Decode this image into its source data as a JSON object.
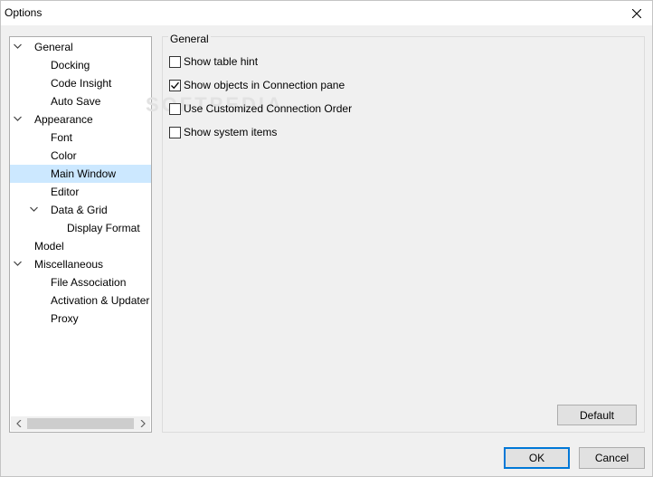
{
  "window": {
    "title": "Options"
  },
  "tree": {
    "items": [
      {
        "label": "General",
        "level": 0,
        "expanded": true
      },
      {
        "label": "Docking",
        "level": 1
      },
      {
        "label": "Code Insight",
        "level": 1
      },
      {
        "label": "Auto Save",
        "level": 1
      },
      {
        "label": "Appearance",
        "level": 0,
        "expanded": true
      },
      {
        "label": "Font",
        "level": 1
      },
      {
        "label": "Color",
        "level": 1
      },
      {
        "label": "Main Window",
        "level": 1,
        "selected": true
      },
      {
        "label": "Editor",
        "level": 1
      },
      {
        "label": "Data & Grid",
        "level": 1,
        "expanded": true
      },
      {
        "label": "Display Format",
        "level": 2
      },
      {
        "label": "Model",
        "level": 0
      },
      {
        "label": "Miscellaneous",
        "level": 0,
        "expanded": true
      },
      {
        "label": "File Association",
        "level": 1
      },
      {
        "label": "Activation & Updater",
        "level": 1
      },
      {
        "label": "Proxy",
        "level": 1
      }
    ]
  },
  "panel": {
    "group_title": "General",
    "options": [
      {
        "label": "Show table hint",
        "checked": false
      },
      {
        "label": "Show objects in Connection pane",
        "checked": true
      },
      {
        "label": "Use Customized Connection Order",
        "checked": false
      },
      {
        "label": "Show system items",
        "checked": false
      }
    ],
    "default_label": "Default"
  },
  "footer": {
    "ok_label": "OK",
    "cancel_label": "Cancel"
  },
  "watermark": "SOFTPEDIA",
  "colors": {
    "selection": "#cce8ff",
    "accent": "#0078d7",
    "background": "#f0f0f0"
  }
}
